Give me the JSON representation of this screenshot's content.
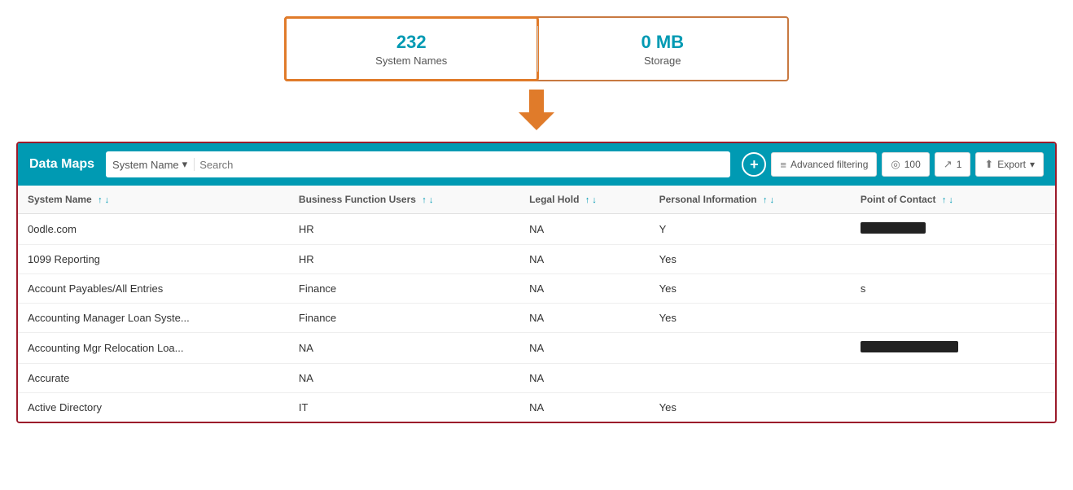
{
  "stats": {
    "system_names_count": "232",
    "system_names_label": "System Names",
    "storage_count": "0 MB",
    "storage_label": "Storage"
  },
  "header": {
    "title": "Data Maps",
    "search_filter_label": "System Name",
    "search_placeholder": "Search",
    "add_button_icon": "+",
    "advanced_filtering_label": "Advanced filtering",
    "count_label": "100",
    "pages_label": "1",
    "export_label": "Export"
  },
  "table": {
    "columns": [
      {
        "label": "System Name",
        "sort": "↑↓"
      },
      {
        "label": "Business Function Users",
        "sort": "↑↓"
      },
      {
        "label": "Legal Hold",
        "sort": "↑↓"
      },
      {
        "label": "Personal Information",
        "sort": "↑↓"
      },
      {
        "label": "Point of Contact",
        "sort": "↑↓"
      }
    ],
    "rows": [
      {
        "system_name": "0odle.com",
        "business_function": "HR",
        "legal_hold": "NA",
        "personal_info": "Y",
        "poc": "redacted",
        "poc_type": "redacted"
      },
      {
        "system_name": "1099 Reporting",
        "business_function": "HR",
        "legal_hold": "NA",
        "personal_info": "Yes",
        "poc": "",
        "poc_type": "none"
      },
      {
        "system_name": "Account Payables/All Entries",
        "business_function": "Finance",
        "legal_hold": "NA",
        "personal_info": "Yes",
        "poc": "s",
        "poc_type": "text"
      },
      {
        "system_name": "Accounting Manager Loan Syste...",
        "business_function": "Finance",
        "legal_hold": "NA",
        "personal_info": "Yes",
        "poc": "",
        "poc_type": "none"
      },
      {
        "system_name": "Accounting Mgr Relocation Loa...",
        "business_function": "NA",
        "legal_hold": "NA",
        "personal_info": "",
        "poc": "redacted-wide",
        "poc_type": "redacted-wide"
      },
      {
        "system_name": "Accurate",
        "business_function": "NA",
        "legal_hold": "NA",
        "personal_info": "",
        "poc": "",
        "poc_type": "none"
      },
      {
        "system_name": "Active Directory",
        "business_function": "IT",
        "legal_hold": "NA",
        "personal_info": "Yes",
        "poc": "",
        "poc_type": "none"
      }
    ]
  }
}
